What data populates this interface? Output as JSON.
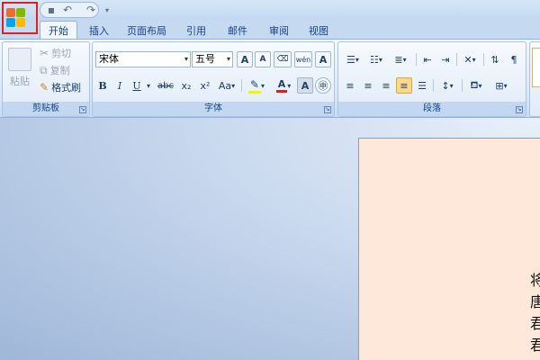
{
  "quick_access": {
    "undo_icon": "undo-icon",
    "redo_icon": "redo-icon"
  },
  "tabs": [
    {
      "label": "开始",
      "active": true
    },
    {
      "label": "插入",
      "active": false
    },
    {
      "label": "页面布局",
      "active": false
    },
    {
      "label": "引用",
      "active": false
    },
    {
      "label": "邮件",
      "active": false
    },
    {
      "label": "审阅",
      "active": false
    },
    {
      "label": "视图",
      "active": false
    }
  ],
  "clipboard": {
    "group_label": "剪贴板",
    "paste_label": "粘贴",
    "cut_label": "剪切",
    "copy_label": "复制",
    "format_painter_label": "格式刷"
  },
  "font": {
    "group_label": "字体",
    "font_name": "宋体",
    "font_size": "五号",
    "bold": "B",
    "italic": "I",
    "underline": "U",
    "strikethrough": "abc",
    "subscript": "x₂",
    "superscript": "x²",
    "change_case": "Aa",
    "grow": "A",
    "shrink": "A",
    "char_border": "A",
    "char_shading": "A",
    "phonetic": "wén",
    "highlight_color": "#f5f500",
    "font_color": "#e02020"
  },
  "paragraph": {
    "group_label": "段落"
  },
  "document": {
    "chars": [
      "将",
      "唐",
      "君",
      "君"
    ]
  },
  "colors": {
    "accent": "#15428b",
    "page": "#fde8d9",
    "office_red": "#e02020"
  }
}
